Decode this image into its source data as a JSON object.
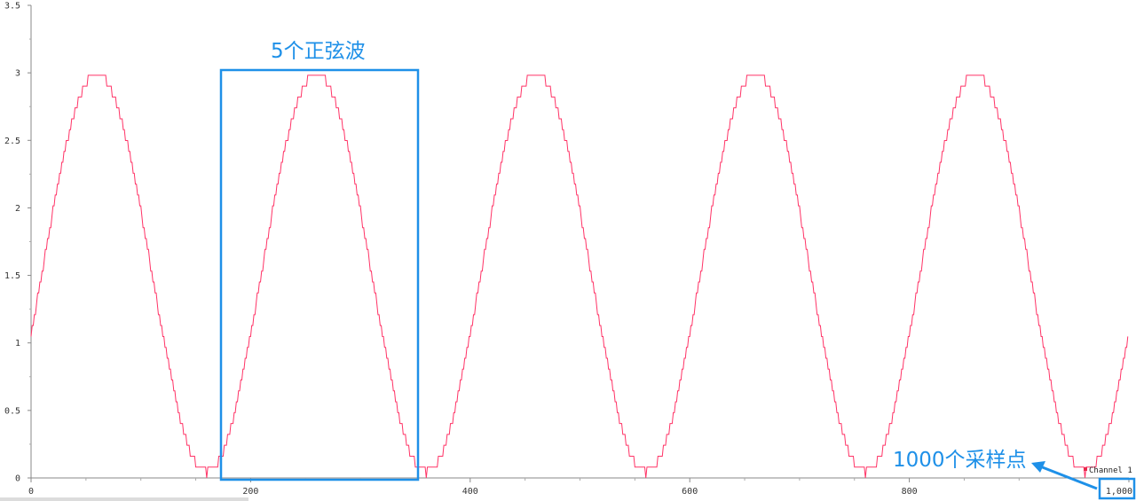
{
  "chart_data": {
    "type": "line",
    "title": "",
    "xlabel": "",
    "ylabel": "",
    "xlim": [
      0,
      1000
    ],
    "ylim": [
      0,
      3.5
    ],
    "x_ticks": [
      0,
      200,
      400,
      600,
      800,
      1000
    ],
    "x_tick_labels": [
      "0",
      "200",
      "400",
      "600",
      "800",
      "1,000"
    ],
    "y_ticks": [
      0,
      0.5,
      1,
      1.5,
      2,
      2.5,
      3,
      3.5
    ],
    "y_tick_labels": [
      "0",
      "0.5",
      "1",
      "1.5",
      "2",
      "2.5",
      "3",
      "3.5"
    ],
    "grid": false,
    "legend_position": "bottom-right",
    "series": [
      {
        "name": "Channel 1",
        "color": "#ff3366",
        "description_values": {
          "n_points": 1000,
          "cycles": 5,
          "period": 200,
          "offset": 1.52,
          "amplitude": 1.48,
          "phase_zero_crossing_x": 10
        }
      }
    ],
    "annotations": [
      {
        "text": "5个正弦波",
        "color": "#1e90e8"
      },
      {
        "text": "1000个采样点",
        "color": "#1e90e8"
      }
    ]
  }
}
